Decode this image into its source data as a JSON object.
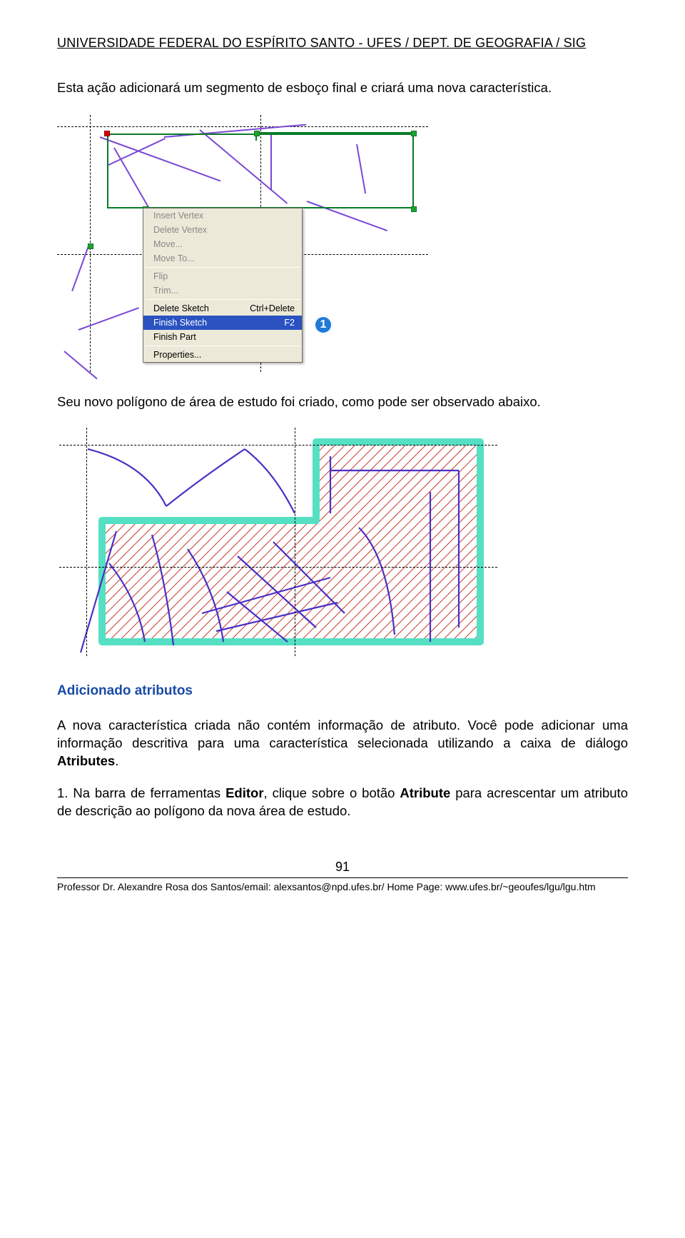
{
  "header": "UNIVERSIDADE FEDERAL DO ESPÍRITO SANTO - UFES / DEPT. DE GEOGRAFIA / SIG",
  "intro_paragraph": "Esta ação adicionará um segmento de esboço final e criará uma nova característica.",
  "context_menu": {
    "items": [
      {
        "label": "Insert Vertex",
        "enabled": false,
        "shortcut": ""
      },
      {
        "label": "Delete Vertex",
        "enabled": false,
        "shortcut": ""
      },
      {
        "label": "Move...",
        "enabled": false,
        "shortcut": ""
      },
      {
        "label": "Move To...",
        "enabled": false,
        "shortcut": ""
      }
    ],
    "items2": [
      {
        "label": "Flip",
        "enabled": false,
        "shortcut": ""
      },
      {
        "label": "Trim...",
        "enabled": false,
        "shortcut": ""
      }
    ],
    "items3": [
      {
        "label": "Delete Sketch",
        "enabled": true,
        "shortcut": "Ctrl+Delete"
      },
      {
        "label": "Finish Sketch",
        "enabled": true,
        "shortcut": "F2",
        "selected": true
      },
      {
        "label": "Finish Part",
        "enabled": true,
        "shortcut": ""
      }
    ],
    "items4": [
      {
        "label": "Properties...",
        "enabled": true,
        "shortcut": ""
      }
    ]
  },
  "callout_number": "1",
  "after_fig1_text": "Seu novo polígono de área de estudo foi criado, como pode ser observado abaixo.",
  "section_title": "Adicionado atributos",
  "attr_para_part1": "A nova característica criada não contém informação de atributo. Você pode adicionar uma informação descritiva para uma característica selecionada utilizando a caixa de diálogo ",
  "attr_para_bold": "Atributes",
  "attr_para_part2": ".",
  "list1_num": "1. ",
  "list1_a": "Na barra de ferramentas ",
  "list1_b1": "Editor",
  "list1_c": ", clique sobre o botão ",
  "list1_b2": "Atribute",
  "list1_d": " para acrescentar um atributo de descrição ao polígono da nova área de estudo.",
  "page_number": "91",
  "footer": "Professor Dr. Alexandre Rosa dos Santos/email: alexsantos@npd.ufes.br/ Home Page: www.ufes.br/~geoufes/lgu/lgu.htm"
}
